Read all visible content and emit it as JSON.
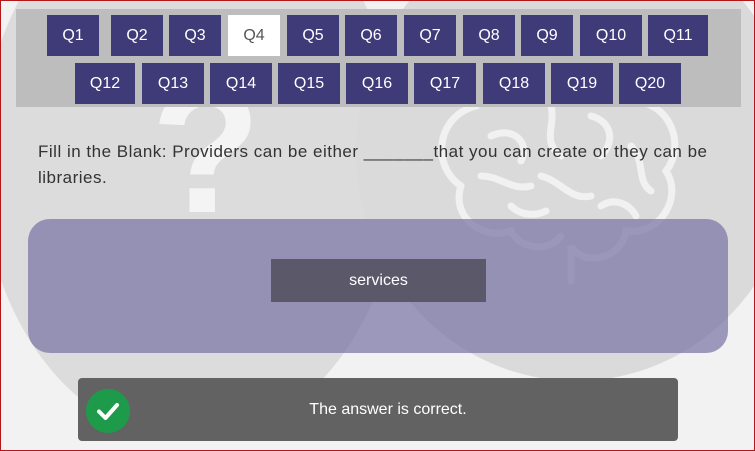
{
  "nav": {
    "questions": [
      "Q1",
      "Q2",
      "Q3",
      "Q4",
      "Q5",
      "Q6",
      "Q7",
      "Q8",
      "Q9",
      "Q10",
      "Q11",
      "Q12",
      "Q13",
      "Q14",
      "Q15",
      "Q16",
      "Q17",
      "Q18",
      "Q19",
      "Q20"
    ],
    "active": "Q4"
  },
  "question": {
    "text": "Fill in the Blank: Providers can be either _______that you can create or they can be libraries."
  },
  "answer": {
    "value": "services"
  },
  "feedback": {
    "message": "The answer is correct.",
    "icon": "check-icon",
    "color": "#1e9b4a"
  },
  "theme": {
    "nav_button": "#3f3a78",
    "panel": "#7874a5"
  }
}
